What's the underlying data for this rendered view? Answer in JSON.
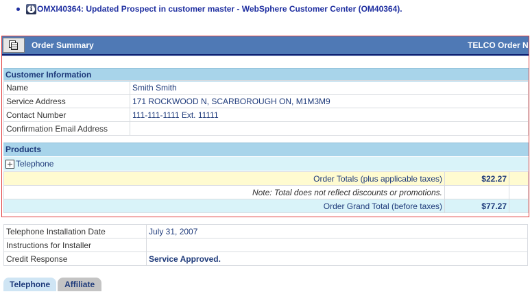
{
  "notice": {
    "title": "OMXI40364: Updated Prospect in customer master - WebSphere Customer Center (OM40364)."
  },
  "order_summary": {
    "title": "Order Summary",
    "right_title": "TELCO Order Nu"
  },
  "customer_info": {
    "heading": "Customer Information",
    "rows": [
      {
        "label": "Name",
        "value": "Smith Smith"
      },
      {
        "label": "Service Address",
        "value": "171 ROCKWOOD N, SCARBOROUGH ON, M1M3M9"
      },
      {
        "label": "Contact Number",
        "value": "111-111-1111  Ext. 11111"
      },
      {
        "label": "Confirmation Email Address",
        "value": ""
      }
    ]
  },
  "products": {
    "heading": "Products",
    "items": [
      {
        "label": "Telephone"
      }
    ]
  },
  "totals": {
    "order_totals_label": "Order Totals (plus applicable taxes)",
    "order_totals_value": "$22.27",
    "note": "Note: Total does not reflect discounts or promotions.",
    "grand_total_label": "Order Grand Total (before taxes)",
    "grand_total_value": "$77.27"
  },
  "installation": {
    "rows": [
      {
        "label": "Telephone Installation Date",
        "value": "July 31, 2007"
      },
      {
        "label": "Instructions for Installer",
        "value": ""
      },
      {
        "label": "Credit Response",
        "value": "Service Approved."
      }
    ]
  },
  "tabs": [
    {
      "label": "Telephone",
      "active": true
    },
    {
      "label": "Affiliate",
      "active": false
    }
  ],
  "colors": {
    "header_bar": "#4f79b5",
    "section_head": "#a8d4ea",
    "frame_border": "#e03a3a",
    "approved": "#2fb02f"
  }
}
